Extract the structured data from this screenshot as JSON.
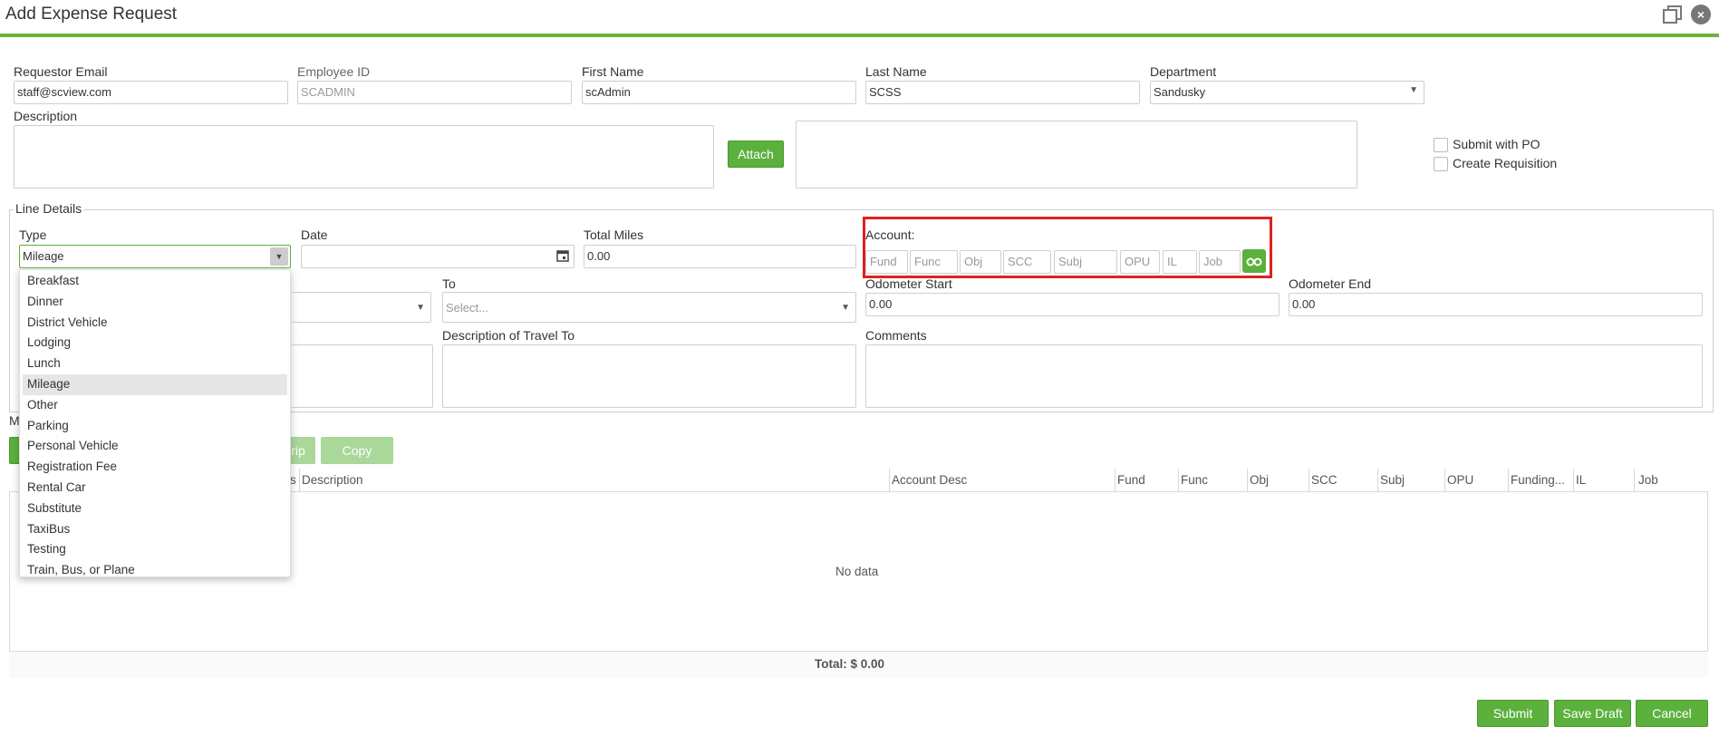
{
  "window": {
    "title": "Add Expense Request"
  },
  "header": {
    "requestor_email_label": "Requestor Email",
    "requestor_email_value": "staff@scview.com",
    "employee_id_label": "Employee ID",
    "employee_id_value": "SCADMIN",
    "first_name_label": "First Name",
    "first_name_value": "scAdmin",
    "last_name_label": "Last Name",
    "last_name_value": "SCSS",
    "department_label": "Department",
    "department_value": "Sandusky",
    "description_label": "Description",
    "attach_label": "Attach",
    "submit_with_po_label": "Submit with PO",
    "create_requisition_label": "Create Requisition"
  },
  "line_details": {
    "legend": "Line Details",
    "type_label": "Type",
    "type_value": "Mileage",
    "date_label": "Date",
    "total_miles_label": "Total Miles",
    "total_miles_value": "0.00",
    "account_label": "Account:",
    "account_fields": [
      "Fund",
      "Func",
      "Obj",
      "SCC",
      "Subj",
      "OPU",
      "IL",
      "Job"
    ],
    "to_label": "To",
    "to_placeholder": "Select...",
    "odometer_start_label": "Odometer Start",
    "odometer_start_value": "0.00",
    "odometer_end_label": "Odometer End",
    "odometer_end_value": "0.00",
    "desc_travel_to_label": "Description of Travel To",
    "comments_label": "Comments"
  },
  "type_dropdown": {
    "options": [
      "Breakfast",
      "Dinner",
      "District Vehicle",
      "Lodging",
      "Lunch",
      "Mileage",
      "Other",
      "Parking",
      "Personal Vehicle",
      "Registration Fee",
      "Rental Car",
      "Substitute",
      "TaxiBus",
      "Testing",
      "Train, Bus, or Plane"
    ],
    "selected": "Mileage"
  },
  "toolbar": {
    "partial_label_m": "M",
    "trip_partial": "rip",
    "copy_label": "Copy"
  },
  "grid": {
    "columns": [
      "s",
      "Description",
      "Account Desc",
      "Fund",
      "Func",
      "Obj",
      "SCC",
      "Subj",
      "OPU",
      "Funding...",
      "IL",
      "Job"
    ],
    "empty_text": "No data",
    "total_text": "Total: $ 0.00"
  },
  "footer": {
    "submit_label": "Submit",
    "save_draft_label": "Save Draft",
    "cancel_label": "Cancel"
  },
  "colors": {
    "accent": "#5cb03c",
    "highlight": "#e02020"
  }
}
